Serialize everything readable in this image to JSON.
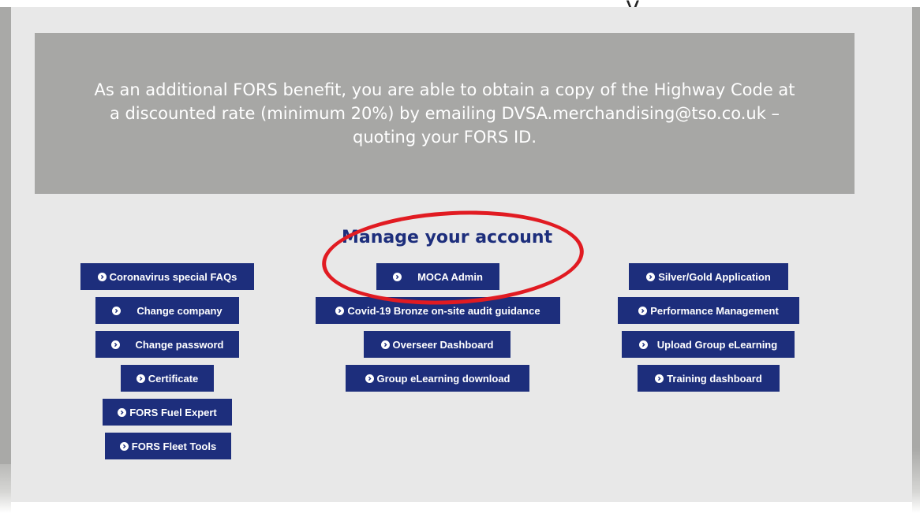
{
  "banner": {
    "text": "As an additional FORS benefit, you are able to obtain a copy of the Highway Code at a discounted rate (minimum 20%) by emailing DVSA.merchandising@tso.co.uk – quoting your FORS ID."
  },
  "top_fragment": "y",
  "section": {
    "heading": "Manage your account"
  },
  "buttons": {
    "left": [
      "Coronavirus special FAQs",
      "Change company",
      "Change password",
      "Certificate",
      "FORS Fuel Expert",
      "FORS Fleet Tools"
    ],
    "center": [
      "MOCA Admin",
      "Covid-19 Bronze on-site audit guidance",
      "Overseer Dashboard",
      "Group eLearning download"
    ],
    "right": [
      "Silver/Gold Application",
      "Performance Management",
      "Upload Group eLearning",
      "Training dashboard"
    ]
  },
  "icon": "chevron-circle-right-icon",
  "colors": {
    "button_bg": "#1d2e7c",
    "heading": "#1d2e7c",
    "highlight_ellipse": "#e11b22",
    "banner_bg": "#a7a7a5",
    "panel_bg": "#e8e8e8"
  }
}
